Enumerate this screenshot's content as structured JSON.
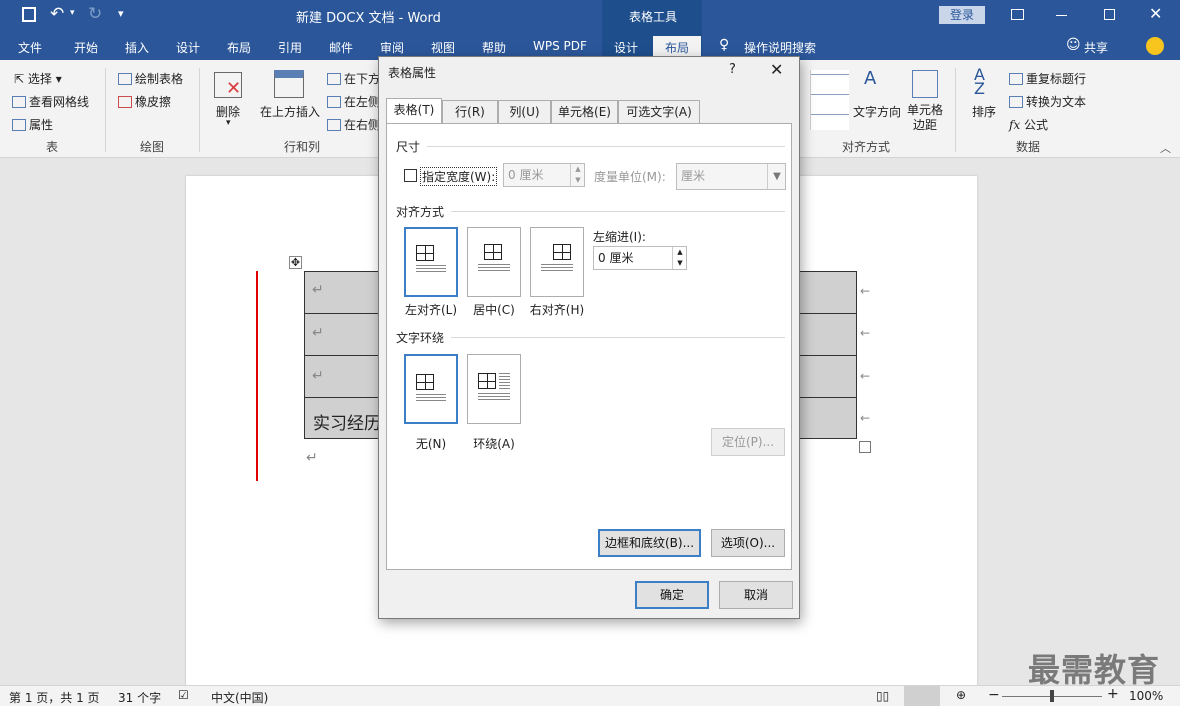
{
  "titlebar": {
    "title": "新建 DOCX 文档  -  Word",
    "context_group": "表格工具",
    "login": "登录",
    "icons": [
      "save-icon",
      "undo-icon",
      "redo-icon",
      "customize-icon",
      "ribbon-display-icon",
      "minimize-icon",
      "maximize-icon",
      "close-icon"
    ]
  },
  "ribbon_tabs": {
    "items": [
      "文件",
      "开始",
      "插入",
      "设计",
      "布局",
      "引用",
      "邮件",
      "审阅",
      "视图",
      "帮助",
      "WPS PDF",
      "设计",
      "布局"
    ],
    "tell_me": "操作说明搜索",
    "share": "共享"
  },
  "ribbon": {
    "table_group": {
      "select": "选择",
      "view_gridlines": "查看网格线",
      "properties": "属性",
      "label": "表"
    },
    "draw_group": {
      "draw_table": "绘制表格",
      "eraser": "橡皮擦",
      "label": "绘图"
    },
    "rows_cols_group": {
      "delete": "删除",
      "insert_above": "在上方插入",
      "insert_below": "在下方",
      "insert_left": "在左侧",
      "insert_right": "在右侧",
      "label": "行和列"
    },
    "alignment_group": {
      "text_direction": "文字方向",
      "cell_margins": "单元格\n边距",
      "label": "对齐方式"
    },
    "data_group": {
      "sort": "排序",
      "repeat_header": "重复标题行",
      "convert_text": "转换为文本",
      "formula": "公式",
      "label": "数据"
    }
  },
  "document": {
    "cell_text": "实习经历"
  },
  "statusbar": {
    "page": "第 1 页，共 1 页",
    "words": "31 个字",
    "language": "中文(中国)",
    "zoom": "100%"
  },
  "dialog": {
    "title": "表格属性",
    "help": "?",
    "tabs": [
      "表格(T)",
      "行(R)",
      "列(U)",
      "单元格(E)",
      "可选文字(A)"
    ],
    "size_section": "尺寸",
    "specify_width": "指定宽度(W):",
    "width_value": "0 厘米",
    "measure_unit_label": "度量单位(M):",
    "measure_unit_value": "厘米",
    "alignment_section": "对齐方式",
    "align_left": "左对齐(L)",
    "align_center": "居中(C)",
    "align_right": "右对齐(H)",
    "indent_label": "左缩进(I):",
    "indent_value": "0 厘米",
    "wrap_section": "文字环绕",
    "wrap_none": "无(N)",
    "wrap_around": "环绕(A)",
    "position_btn": "定位(P)...",
    "borders_btn": "边框和底纹(B)...",
    "options_btn": "选项(O)...",
    "ok_btn": "确定",
    "cancel_btn": "取消"
  },
  "watermark": "最需教育",
  "colors": {
    "accent": "#2b579a",
    "selection": "#3c7fc6",
    "red_line": "#e00000"
  }
}
